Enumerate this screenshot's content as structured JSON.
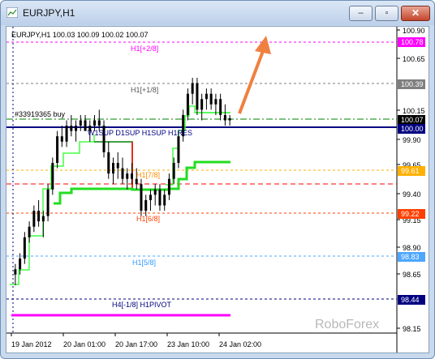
{
  "window": {
    "title": "EURJPY,H1",
    "buttons": {
      "minimize": "–",
      "maximize": "▫",
      "close": "✕"
    }
  },
  "chart_data": {
    "type": "candlestick",
    "header": "EURJPY,H1  100.03 100.09 100.02 100.07",
    "ylim": [
      98.05,
      100.93
    ],
    "y_ticks": [
      "100.90",
      "100.65",
      "100.15",
      "99.90",
      "99.65",
      "99.40",
      "99.15",
      "98.90",
      "98.65",
      "98.15"
    ],
    "x_ticks": [
      "19 Jan 2012",
      "20 Jan 01:00",
      "20 Jan 17:00",
      "23 Jan 10:00",
      "24 Jan 02:00"
    ],
    "price_badges": [
      {
        "text": "100.78",
        "bg": "#ff00ff"
      },
      {
        "text": "100.39",
        "bg": "#7f7f7f"
      },
      {
        "text": "100.07",
        "bg": "#000000"
      },
      {
        "text": "100.00",
        "bg": "#000080"
      },
      {
        "text": "99.61",
        "bg": "#ffb000"
      },
      {
        "text": "99.22",
        "bg": "#ff4000"
      },
      {
        "text": "98.83",
        "bg": "#4da6ff"
      },
      {
        "text": "98.44",
        "bg": "#000080"
      }
    ],
    "levels": [
      {
        "text": "H1[+2/8]",
        "color": "#ff00ff"
      },
      {
        "text": "H1[+1/8]",
        "color": "#555555"
      },
      {
        "text": "H1[7/8]",
        "color": "#ff8c00"
      },
      {
        "text": "H1[6/8]",
        "color": "#ff4000"
      },
      {
        "text": "H1[5/8]",
        "color": "#3399ff"
      },
      {
        "text": "H4[-1/8] H1PIVOT",
        "color": "#000080"
      },
      {
        "text": "W1SUP D1SUP H1SUP H1RES",
        "color": "#000080"
      }
    ],
    "order_label": "#33919365 buy",
    "watermark": "RoboForex",
    "candles": [
      [
        98.6,
        98.7,
        98.5,
        98.65
      ],
      [
        98.65,
        98.8,
        98.6,
        98.75
      ],
      [
        98.75,
        99.0,
        98.7,
        98.95
      ],
      [
        98.95,
        99.1,
        98.9,
        99.05
      ],
      [
        99.05,
        99.25,
        99.0,
        99.2
      ],
      [
        99.2,
        99.3,
        99.05,
        99.1
      ],
      [
        99.1,
        99.2,
        98.95,
        99.15
      ],
      [
        99.15,
        99.45,
        99.1,
        99.4
      ],
      [
        99.4,
        99.7,
        99.35,
        99.65
      ],
      [
        99.65,
        99.95,
        99.6,
        99.9
      ],
      [
        99.9,
        100.0,
        99.8,
        99.85
      ],
      [
        99.85,
        100.05,
        99.8,
        100.0
      ],
      [
        100.0,
        100.1,
        99.9,
        99.95
      ],
      [
        99.95,
        100.05,
        99.85,
        100.0
      ],
      [
        100.0,
        100.1,
        99.95,
        100.05
      ],
      [
        100.05,
        100.1,
        99.95,
        99.95
      ],
      [
        99.95,
        100.05,
        99.85,
        100.0
      ],
      [
        100.0,
        100.1,
        99.95,
        100.05
      ],
      [
        100.05,
        100.15,
        99.95,
        100.0
      ],
      [
        100.0,
        100.05,
        99.7,
        99.75
      ],
      [
        99.75,
        99.85,
        99.5,
        99.55
      ],
      [
        99.55,
        99.7,
        99.45,
        99.65
      ],
      [
        99.65,
        99.75,
        99.5,
        99.6
      ],
      [
        99.6,
        99.7,
        99.45,
        99.5
      ],
      [
        99.5,
        99.6,
        99.4,
        99.55
      ],
      [
        99.55,
        99.65,
        99.45,
        99.5
      ],
      [
        99.5,
        99.6,
        99.4,
        99.45
      ],
      [
        99.45,
        99.5,
        99.15,
        99.2
      ],
      [
        99.2,
        99.35,
        99.15,
        99.3
      ],
      [
        99.3,
        99.4,
        99.2,
        99.35
      ],
      [
        99.35,
        99.45,
        99.25,
        99.4
      ],
      [
        99.4,
        99.45,
        99.2,
        99.25
      ],
      [
        99.25,
        99.4,
        99.2,
        99.35
      ],
      [
        99.35,
        99.55,
        99.3,
        99.5
      ],
      [
        99.5,
        99.7,
        99.45,
        99.65
      ],
      [
        99.65,
        99.95,
        99.6,
        99.9
      ],
      [
        99.9,
        100.15,
        99.85,
        100.1
      ],
      [
        100.1,
        100.35,
        100.05,
        100.3
      ],
      [
        100.3,
        100.45,
        100.2,
        100.4
      ],
      [
        100.4,
        100.45,
        100.1,
        100.15
      ],
      [
        100.15,
        100.3,
        100.05,
        100.25
      ],
      [
        100.25,
        100.35,
        100.15,
        100.3
      ],
      [
        100.3,
        100.35,
        100.15,
        100.2
      ],
      [
        100.2,
        100.3,
        100.1,
        100.25
      ],
      [
        100.25,
        100.3,
        100.05,
        100.1
      ],
      [
        100.1,
        100.2,
        100.0,
        100.05
      ],
      [
        100.05,
        100.1,
        100.0,
        100.07
      ]
    ]
  }
}
